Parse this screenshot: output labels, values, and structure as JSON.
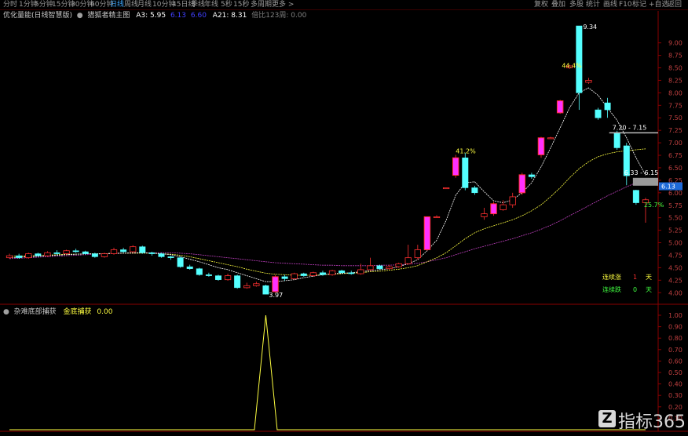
{
  "toolbar": {
    "items": [
      "分时",
      "1分钟",
      "5分钟",
      "15分钟",
      "30分钟",
      "60分钟",
      "日线",
      "周线",
      "月线",
      "10分钟",
      "45日线",
      "季线",
      "年线",
      "5秒",
      "15秒",
      "多周期",
      "更多 >"
    ],
    "active_index": 6,
    "right_items": [
      "复权",
      "叠加",
      "多股",
      "统计",
      "画线",
      "F10",
      "标记",
      "+自选",
      "返回"
    ]
  },
  "upper_legend": {
    "name": "优化量能(日线智慧版)",
    "indicator": "猎狐者精主图",
    "a3": "A3: 5.95",
    "v2": "6.13",
    "v3": "6.60",
    "a21": "A21: 8.31",
    "extra": "倍比123周: 0.00"
  },
  "lower_legend": {
    "name": "杂难底部捕获",
    "item": "金底捕获",
    "value": "0.00"
  },
  "annotations": {
    "peak": "9.34",
    "peak_pct": "44.4%",
    "mid_pct": "41.2%",
    "low": "3.97",
    "range1": "7.20 - 7.15",
    "range2": "6.33 - 6.15",
    "end_pct": "25.7%",
    "price_tag": "6.13"
  },
  "stats": {
    "up_label": "连续涨",
    "up_value": "1",
    "up_unit": "天",
    "down_label": "连续跌",
    "down_value": "0",
    "down_unit": "天"
  },
  "watermark": "指标365",
  "colors": {
    "up": "#ff3030",
    "up_fill": "#ff30ff",
    "down": "#54ffff",
    "ma_white": "#ffffff",
    "ma_yellow": "#ffff40",
    "ma_purple": "#c040c0",
    "grid": "#5a0000"
  },
  "chart_data": [
    {
      "type": "candlestick",
      "title": "猎狐者精主图",
      "y_axis_ticks": [
        "9.00",
        "8.75",
        "8.50",
        "8.25",
        "8.00",
        "7.75",
        "7.50",
        "7.25",
        "7.00",
        "6.75",
        "6.50",
        "6.25",
        "6.00",
        "5.75",
        "5.50",
        "5.25",
        "5.00",
        "4.75",
        "4.50",
        "4.25",
        "4.00"
      ],
      "ylim": [
        3.8,
        9.45
      ],
      "candles": [
        {
          "o": 4.7,
          "c": 4.74,
          "h": 4.78,
          "l": 4.68
        },
        {
          "o": 4.74,
          "c": 4.7,
          "h": 4.78,
          "l": 4.68
        },
        {
          "o": 4.7,
          "c": 4.78,
          "h": 4.8,
          "l": 4.68
        },
        {
          "o": 4.78,
          "c": 4.74,
          "h": 4.8,
          "l": 4.72
        },
        {
          "o": 4.74,
          "c": 4.8,
          "h": 4.83,
          "l": 4.72
        },
        {
          "o": 4.8,
          "c": 4.78,
          "h": 4.85,
          "l": 4.76
        },
        {
          "o": 4.78,
          "c": 4.84,
          "h": 4.86,
          "l": 4.76
        },
        {
          "o": 4.84,
          "c": 4.82,
          "h": 4.88,
          "l": 4.8
        },
        {
          "o": 4.82,
          "c": 4.78,
          "h": 4.84,
          "l": 4.76
        },
        {
          "o": 4.78,
          "c": 4.72,
          "h": 4.8,
          "l": 4.7
        },
        {
          "o": 4.72,
          "c": 4.78,
          "h": 4.8,
          "l": 4.7
        },
        {
          "o": 4.78,
          "c": 4.86,
          "h": 4.9,
          "l": 4.76
        },
        {
          "o": 4.86,
          "c": 4.82,
          "h": 4.9,
          "l": 4.8
        },
        {
          "o": 4.82,
          "c": 4.92,
          "h": 4.95,
          "l": 4.8
        },
        {
          "o": 4.92,
          "c": 4.8,
          "h": 4.94,
          "l": 4.78
        },
        {
          "o": 4.8,
          "c": 4.78,
          "h": 4.82,
          "l": 4.74
        },
        {
          "o": 4.78,
          "c": 4.72,
          "h": 4.8,
          "l": 4.7
        },
        {
          "o": 4.72,
          "c": 4.7,
          "h": 4.74,
          "l": 4.66
        },
        {
          "o": 4.7,
          "c": 4.52,
          "h": 4.72,
          "l": 4.5
        },
        {
          "o": 4.52,
          "c": 4.48,
          "h": 4.56,
          "l": 4.46
        },
        {
          "o": 4.48,
          "c": 4.36,
          "h": 4.5,
          "l": 4.34
        },
        {
          "o": 4.36,
          "c": 4.34,
          "h": 4.4,
          "l": 4.32
        },
        {
          "o": 4.34,
          "c": 4.26,
          "h": 4.36,
          "l": 4.24
        },
        {
          "o": 4.26,
          "c": 4.34,
          "h": 4.38,
          "l": 4.24
        },
        {
          "o": 4.34,
          "c": 4.1,
          "h": 4.36,
          "l": 4.08
        },
        {
          "o": 4.1,
          "c": 4.14,
          "h": 4.2,
          "l": 4.08
        },
        {
          "o": 4.14,
          "c": 4.18,
          "h": 4.22,
          "l": 4.12
        },
        {
          "o": 4.14,
          "c": 3.97,
          "h": 4.16,
          "l": 3.97
        },
        {
          "o": 4.02,
          "c": 4.32,
          "h": 4.36,
          "l": 4.0
        },
        {
          "o": 4.32,
          "c": 4.28,
          "h": 4.36,
          "l": 4.24
        },
        {
          "o": 4.28,
          "c": 4.38,
          "h": 4.4,
          "l": 4.26
        },
        {
          "o": 4.38,
          "c": 4.34,
          "h": 4.4,
          "l": 4.32
        },
        {
          "o": 4.34,
          "c": 4.4,
          "h": 4.42,
          "l": 4.32
        },
        {
          "o": 4.4,
          "c": 4.36,
          "h": 4.44,
          "l": 4.34
        },
        {
          "o": 4.36,
          "c": 4.44,
          "h": 4.46,
          "l": 4.34
        },
        {
          "o": 4.44,
          "c": 4.4,
          "h": 4.46,
          "l": 4.38
        },
        {
          "o": 4.4,
          "c": 4.38,
          "h": 4.44,
          "l": 4.36
        },
        {
          "o": 4.38,
          "c": 4.46,
          "h": 4.58,
          "l": 4.36
        },
        {
          "o": 4.46,
          "c": 4.54,
          "h": 4.7,
          "l": 4.44
        },
        {
          "o": 4.54,
          "c": 4.48,
          "h": 4.56,
          "l": 4.46
        },
        {
          "o": 4.48,
          "c": 4.52,
          "h": 4.56,
          "l": 4.46
        },
        {
          "o": 4.52,
          "c": 4.58,
          "h": 4.6,
          "l": 4.5
        },
        {
          "o": 4.58,
          "c": 4.7,
          "h": 4.96,
          "l": 4.56
        },
        {
          "o": 4.7,
          "c": 4.86,
          "h": 4.96,
          "l": 4.66
        },
        {
          "o": 4.86,
          "c": 5.52,
          "h": 5.52,
          "l": 4.84
        },
        {
          "o": 5.52,
          "c": 5.52,
          "h": 5.55,
          "l": 5.5
        },
        {
          "o": 6.1,
          "c": 6.1,
          "h": 6.1,
          "l": 6.1
        },
        {
          "o": 6.35,
          "c": 6.7,
          "h": 6.76,
          "l": 6.3
        },
        {
          "o": 6.7,
          "c": 6.1,
          "h": 6.8,
          "l": 6.05
        },
        {
          "o": 6.1,
          "c": 6.0,
          "h": 6.14,
          "l": 5.96
        },
        {
          "o": 5.52,
          "c": 5.58,
          "h": 5.7,
          "l": 5.46
        },
        {
          "o": 5.58,
          "c": 5.78,
          "h": 5.82,
          "l": 5.54
        },
        {
          "o": 5.66,
          "c": 5.76,
          "h": 5.85,
          "l": 5.64
        },
        {
          "o": 5.76,
          "c": 5.92,
          "h": 6.0,
          "l": 5.7
        },
        {
          "o": 6.0,
          "c": 6.36,
          "h": 6.4,
          "l": 5.96
        },
        {
          "o": 6.36,
          "c": 6.32,
          "h": 6.4,
          "l": 6.28
        },
        {
          "o": 6.76,
          "c": 7.1,
          "h": 7.12,
          "l": 6.7
        },
        {
          "o": 7.1,
          "c": 7.1,
          "h": 7.12,
          "l": 7.08
        },
        {
          "o": 7.6,
          "c": 7.84,
          "h": 7.86,
          "l": 7.58
        },
        {
          "o": 8.5,
          "c": 8.54,
          "h": 8.56,
          "l": 8.48
        },
        {
          "o": 9.34,
          "c": 8.0,
          "h": 9.34,
          "l": 7.66
        },
        {
          "o": 8.21,
          "c": 8.25,
          "h": 8.3,
          "l": 8.18
        },
        {
          "o": 7.66,
          "c": 7.5,
          "h": 7.7,
          "l": 7.46
        },
        {
          "o": 7.8,
          "c": 7.66,
          "h": 7.9,
          "l": 7.5
        },
        {
          "o": 7.2,
          "c": 6.9,
          "h": 7.24,
          "l": 6.86
        },
        {
          "o": 6.94,
          "c": 6.34,
          "h": 7.0,
          "l": 6.15
        },
        {
          "o": 6.05,
          "c": 5.8,
          "h": 6.06,
          "l": 5.76
        },
        {
          "o": 5.8,
          "c": 5.86,
          "h": 5.9,
          "l": 5.4
        }
      ],
      "ma_white": [
        4.7,
        4.71,
        4.72,
        4.73,
        4.74,
        4.75,
        4.76,
        4.77,
        4.78,
        4.78,
        4.78,
        4.79,
        4.79,
        4.8,
        4.8,
        4.79,
        4.78,
        4.76,
        4.72,
        4.67,
        4.62,
        4.56,
        4.5,
        4.46,
        4.4,
        4.34,
        4.28,
        4.22,
        4.22,
        4.24,
        4.26,
        4.3,
        4.33,
        4.36,
        4.38,
        4.39,
        4.4,
        4.42,
        4.44,
        4.46,
        4.48,
        4.52,
        4.58,
        4.66,
        4.84,
        5.05,
        5.45,
        5.95,
        6.2,
        6.22,
        6.02,
        5.84,
        5.8,
        5.86,
        6.0,
        6.2,
        6.52,
        6.9,
        7.3,
        7.7,
        8.0,
        8.1,
        7.95,
        7.7,
        7.45,
        7.1,
        6.7,
        6.35
      ],
      "ma_yellow": [
        4.73,
        4.73,
        4.74,
        4.74,
        4.75,
        4.76,
        4.77,
        4.77,
        4.78,
        4.78,
        4.78,
        4.79,
        4.79,
        4.79,
        4.79,
        4.79,
        4.78,
        4.77,
        4.75,
        4.72,
        4.68,
        4.64,
        4.6,
        4.56,
        4.52,
        4.47,
        4.43,
        4.39,
        4.37,
        4.36,
        4.35,
        4.35,
        4.35,
        4.36,
        4.37,
        4.38,
        4.39,
        4.4,
        4.42,
        4.43,
        4.45,
        4.47,
        4.5,
        4.54,
        4.62,
        4.7,
        4.8,
        4.94,
        5.08,
        5.2,
        5.28,
        5.34,
        5.4,
        5.46,
        5.54,
        5.64,
        5.76,
        5.92,
        6.1,
        6.3,
        6.48,
        6.62,
        6.72,
        6.78,
        6.82,
        6.84,
        6.86,
        6.88
      ],
      "ma_purple": [
        4.68,
        4.69,
        4.7,
        4.71,
        4.72,
        4.73,
        4.74,
        4.75,
        4.76,
        4.77,
        4.78,
        4.78,
        4.79,
        4.79,
        4.8,
        4.8,
        4.8,
        4.8,
        4.79,
        4.78,
        4.76,
        4.74,
        4.72,
        4.7,
        4.68,
        4.66,
        4.64,
        4.62,
        4.6,
        4.59,
        4.58,
        4.57,
        4.56,
        4.55,
        4.55,
        4.54,
        4.54,
        4.54,
        4.54,
        4.55,
        4.55,
        4.56,
        4.57,
        4.59,
        4.62,
        4.66,
        4.7,
        4.76,
        4.82,
        4.88,
        4.93,
        4.98,
        5.03,
        5.08,
        5.14,
        5.2,
        5.27,
        5.35,
        5.44,
        5.54,
        5.64,
        5.74,
        5.84,
        5.94,
        6.03,
        6.12,
        6.2,
        6.28
      ]
    },
    {
      "type": "line",
      "title": "杂难底部捕获",
      "y_axis_ticks": [
        "1.00",
        "0.90",
        "0.80",
        "0.70",
        "0.60",
        "0.50",
        "0.40",
        "0.30",
        "0.20",
        "0.10"
      ],
      "ylim": [
        0,
        1.0
      ],
      "series": [
        {
          "name": "金底捕获",
          "values": [
            0,
            0,
            0,
            0,
            0,
            0,
            0,
            0,
            0,
            0,
            0,
            0,
            0,
            0,
            0,
            0,
            0,
            0,
            0,
            0,
            0,
            0,
            0,
            0,
            0,
            0,
            0,
            0,
            0,
            0,
            0,
            0,
            0,
            0,
            0,
            0,
            0,
            0,
            0,
            0,
            0,
            0,
            0,
            0,
            0,
            0,
            0,
            0,
            0,
            0,
            0,
            0,
            0,
            0,
            0,
            0,
            0,
            0,
            0,
            0,
            0,
            0,
            0,
            0,
            0,
            0,
            0,
            0
          ],
          "spike_index": 27,
          "spike_value": 1.0
        }
      ]
    }
  ]
}
